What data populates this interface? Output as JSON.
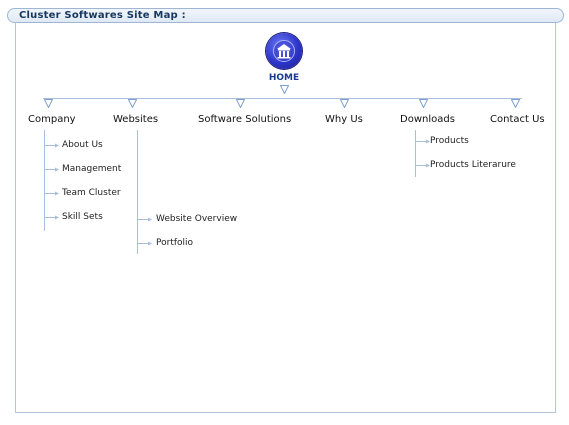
{
  "page_title": "Cluster Softwares Site Map :",
  "home": {
    "label": "HOME",
    "icon": "home-building-icon"
  },
  "categories": [
    {
      "label": "Company",
      "items": [
        "About Us",
        "Management",
        "Team Cluster",
        "Skill Sets"
      ]
    },
    {
      "label": "Websites",
      "items": [
        "Website Overview",
        "Portfolio"
      ]
    },
    {
      "label": "Software Solutions",
      "items": []
    },
    {
      "label": "Why Us",
      "items": []
    },
    {
      "label": "Downloads",
      "items": [
        "Products",
        "Products Literarure"
      ]
    },
    {
      "label": "Contact Us",
      "items": []
    }
  ],
  "colors": {
    "connector": "#a8bedb",
    "title": "#17375e",
    "home_blue": "#2d34c9"
  }
}
